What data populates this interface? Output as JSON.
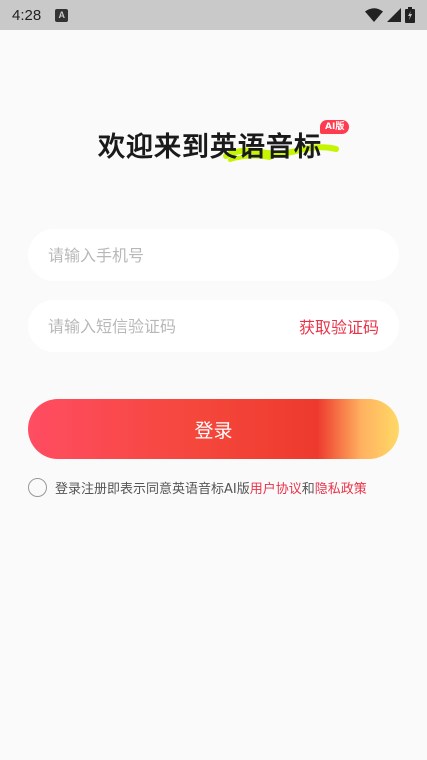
{
  "status_bar": {
    "time": "4:28",
    "notification_icon": "A"
  },
  "header": {
    "title": "欢迎来到英语音标",
    "badge": "AI版"
  },
  "form": {
    "phone_placeholder": "请输入手机号",
    "code_placeholder": "请输入短信验证码",
    "get_code_label": "获取验证码",
    "login_label": "登录"
  },
  "agreement": {
    "prefix": "登录注册即表示同意英语音标AI版",
    "user_agreement": "用户协议",
    "conjunction": "和",
    "privacy_policy": "隐私政策"
  },
  "colors": {
    "accent": "#e8344a",
    "highlight": "#c6f500"
  }
}
